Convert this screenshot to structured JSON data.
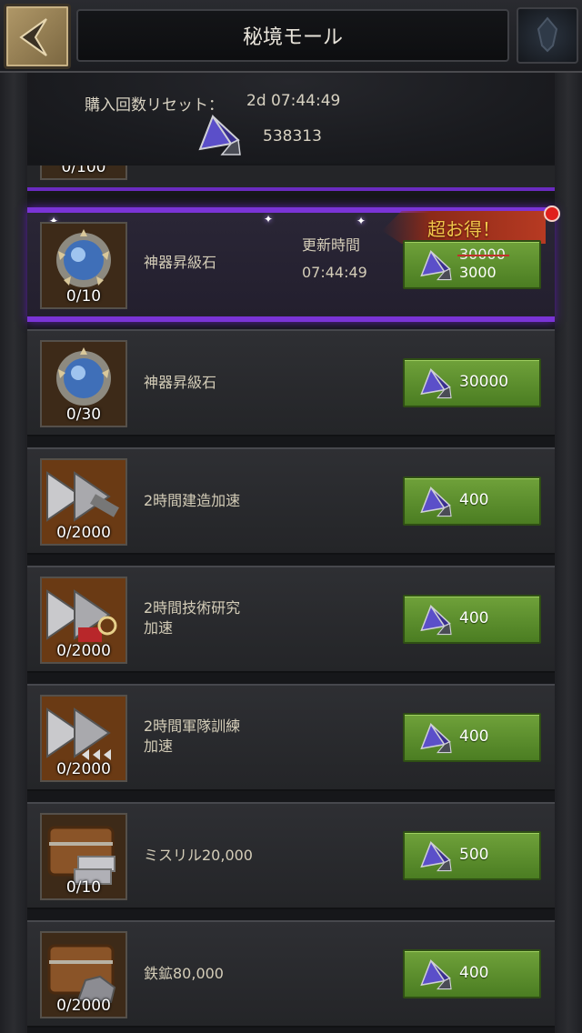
{
  "header": {
    "back_icon": "chevron-left-icon",
    "title": "秘境モール",
    "crest_icon": "crest-emblem-icon"
  },
  "info": {
    "reset_label": "購入回数リセット：",
    "reset_value": "2d 07:44:49",
    "currency_icon": "gem-pyramid-icon",
    "currency_value": "538313"
  },
  "items": [
    {
      "stock": "0/100"
    },
    {
      "name": "神器昇級石",
      "stock": "0/10",
      "refresh_label": "更新時間",
      "refresh_time": "07:44:49",
      "badge": "超お得！",
      "price_old": "30000",
      "price_new": "3000",
      "icon": "blue-orb-icon"
    },
    {
      "name": "神器昇級石",
      "stock": "0/30",
      "price": "30000",
      "icon": "blue-orb-icon"
    },
    {
      "name": "2時間建造加速",
      "stock": "0/2000",
      "price": "400",
      "icon": "speedup-build-icon"
    },
    {
      "name_line1": "2時間技術研究",
      "name_line2": "加速",
      "stock": "0/2000",
      "price": "400",
      "icon": "speedup-research-icon"
    },
    {
      "name_line1": "2時間軍隊訓練",
      "name_line2": "加速",
      "stock": "0/2000",
      "price": "400",
      "icon": "speedup-train-icon"
    },
    {
      "name": "ミスリル20,000",
      "stock": "0/10",
      "price": "500",
      "icon": "mithril-chest-icon"
    },
    {
      "name": "鉄鉱80,000",
      "stock": "0/2000",
      "price": "400",
      "icon": "iron-chest-icon"
    }
  ],
  "colors": {
    "buy_button": "#5a8c2c",
    "featured_border": "#7a34d6",
    "badge_text": "#f0c64a"
  }
}
